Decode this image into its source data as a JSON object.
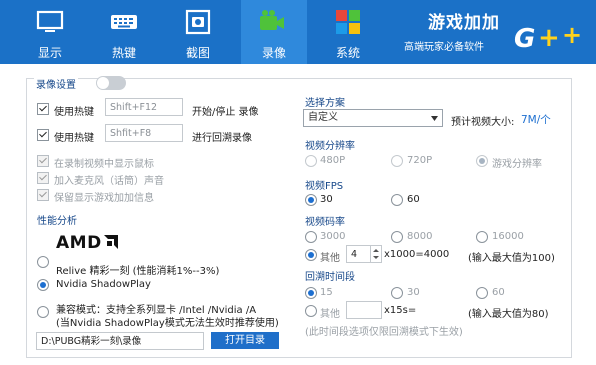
{
  "tabs": [
    {
      "label": "显示",
      "icon": "monitor-icon"
    },
    {
      "label": "热键",
      "icon": "keyboard-icon"
    },
    {
      "label": "截图",
      "icon": "screenshot-icon"
    },
    {
      "label": "录像",
      "icon": "video-camera-icon",
      "active": true
    },
    {
      "label": "系统",
      "icon": "system-tiles-icon"
    }
  ],
  "brand": {
    "title": "游戏加加",
    "subtitle": "高端玩家必备软件",
    "logo": "G++"
  },
  "left": {
    "record_settings": "录像设置",
    "hotkey1": {
      "label": "使用热键",
      "value": "Shift+F12",
      "action": "开始/停止 录像"
    },
    "hotkey2": {
      "label": "使用热键",
      "value": "Shfit+F8",
      "action": "进行回溯录像"
    },
    "opt_mouse": "在录制视频中显示鼠标",
    "opt_mic": "加入麦克风（话筒）声音",
    "opt_info": "保留显示游戏加加信息",
    "perf_title": "性能分析",
    "amd_logo": "AMD",
    "relive": "Relive 精彩一刻 (性能消耗1%--3%)",
    "nvidia": "Nvidia ShadowPlay",
    "compat1": "兼容模式：支持全系列显卡 /Intel /Nvidia /A",
    "compat2": "(当Nvidia ShadowPlay模式无法生效时推荐使用)",
    "path": "D:\\PUBG精彩一刻\\录像",
    "open_dir": "打开目录"
  },
  "right": {
    "scheme_title": "选择方案",
    "scheme_value": "自定义",
    "est_label": "预计视频大小:",
    "est_value": "7M/个",
    "res_title": "视频分辨率",
    "res_opts": [
      "480P",
      "720P",
      "游戏分辨率"
    ],
    "fps_title": "视频FPS",
    "fps_opts": [
      "30",
      "60"
    ],
    "bit_title": "视频码率",
    "bit_opts": [
      "3000",
      "8000",
      "16000"
    ],
    "bit_other": "其他",
    "bit_input": "4",
    "bit_formula": "x1000=4000",
    "bit_hint": "(输入最大值为100)",
    "back_title": "回溯时间段",
    "back_opts": [
      "15",
      "30",
      "60"
    ],
    "back_other": "其他",
    "back_input": "",
    "back_formula": "x15s=",
    "back_hint": "(输入最大值为80)",
    "back_note": "(此时间段选项仅限回溯模式下生效)"
  },
  "colors": {
    "header": "#1b71c7",
    "active_tab": "#2f89dc",
    "accent": "#1d6fd0",
    "section": "#17488a"
  }
}
